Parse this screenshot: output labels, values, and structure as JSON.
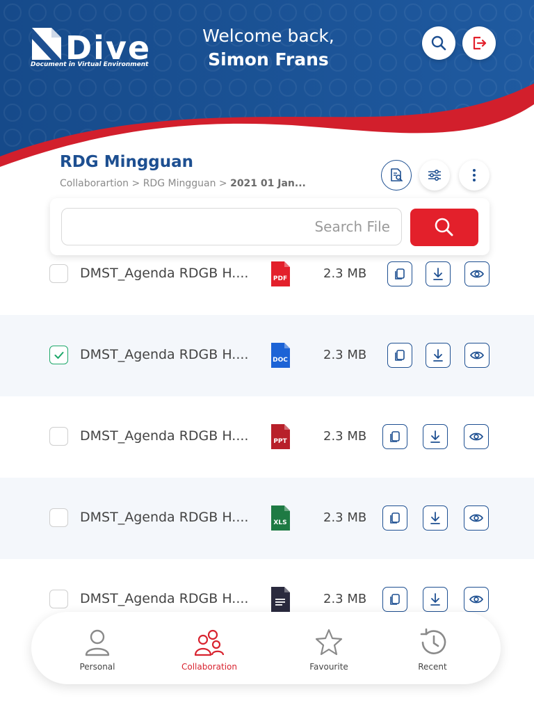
{
  "app": {
    "logo_text": "Dive",
    "tagline": "Document in Virtual Environment",
    "welcome_line1": "Welcome back,",
    "user_name": "Simon Frans",
    "header_actions": [
      {
        "icon": "search-icon"
      },
      {
        "icon": "logout-icon"
      }
    ]
  },
  "folder": {
    "title": "RDG Mingguan",
    "breadcrumb_path": "Collaborartion > RDG Mingguan > ",
    "breadcrumb_current": "2021 01 Jan...",
    "actions": [
      {
        "icon": "document-search-icon"
      },
      {
        "icon": "filter-sliders-icon"
      },
      {
        "icon": "more-vertical-icon"
      }
    ]
  },
  "search": {
    "placeholder": "Search File",
    "value": ""
  },
  "files": [
    {
      "name": "DMST_Agenda RDGB H....",
      "type": "PDF",
      "size": "2.3 MB",
      "checked": false
    },
    {
      "name": "DMST_Agenda RDGB H....",
      "type": "DOC",
      "size": "2.3 MB",
      "checked": true
    },
    {
      "name": "DMST_Agenda RDGB H....",
      "type": "PPT",
      "size": "2.3 MB",
      "checked": false
    },
    {
      "name": "DMST_Agenda RDGB H....",
      "type": "XLS",
      "size": "2.3 MB",
      "checked": false
    },
    {
      "name": "DMST_Agenda RDGB H....",
      "type": "TXT",
      "size": "2.3 MB",
      "checked": false
    }
  ],
  "file_type_colors": {
    "PDF": "#e3202b",
    "DOC": "#1c63d6",
    "PPT": "#b8202a",
    "XLS": "#1e7a43",
    "TXT": "#2a2a3e"
  },
  "nav": [
    {
      "label": "Personal",
      "icon": "person-icon",
      "active": false
    },
    {
      "label": "Collaboration",
      "icon": "group-icon",
      "active": true
    },
    {
      "label": "Favourite",
      "icon": "star-icon",
      "active": false
    },
    {
      "label": "Recent",
      "icon": "history-icon",
      "active": false
    }
  ],
  "colors": {
    "brand_blue": "#1d4f91",
    "accent_red": "#e3202b",
    "check_green": "#1ea86a"
  }
}
